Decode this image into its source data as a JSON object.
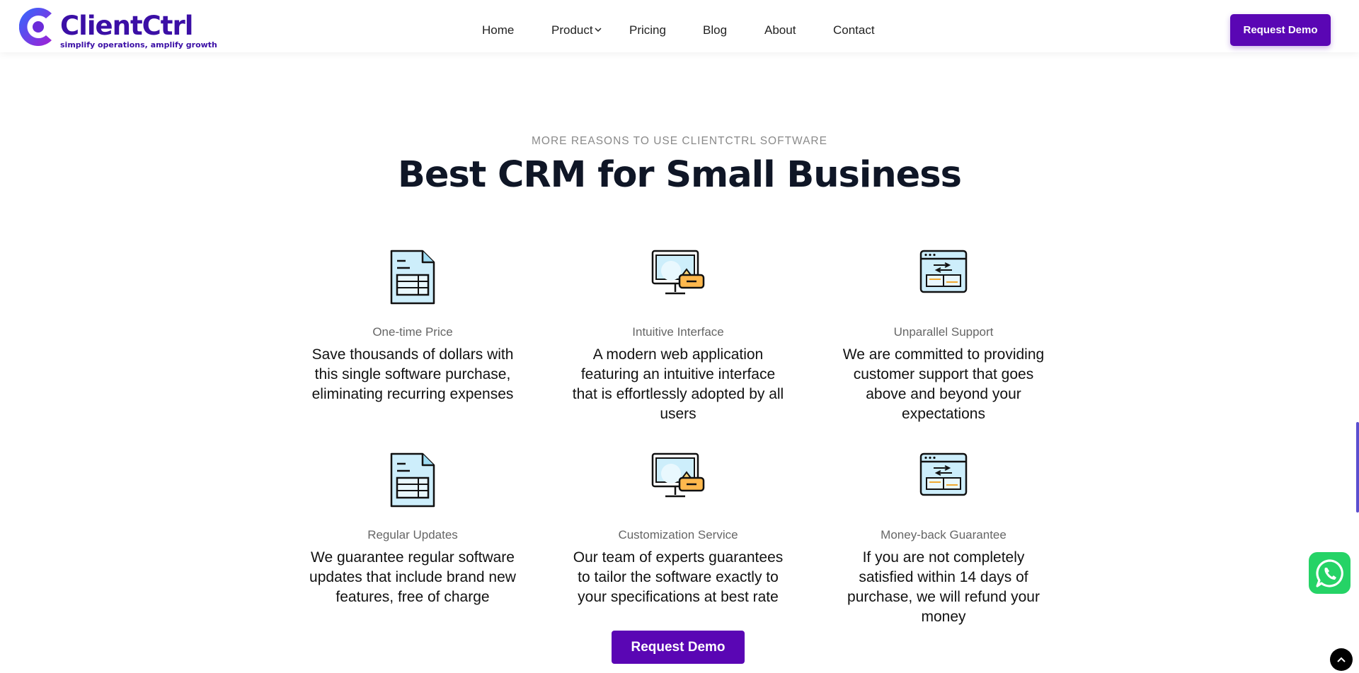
{
  "brand": {
    "name": "ClientCtrl",
    "tagline": "simplify operations, amplify growth",
    "colors": {
      "primary": "#5a06b4",
      "logo_gradient_start": "#2f6bff",
      "logo_gradient_end": "#a11fd4"
    }
  },
  "nav": {
    "items": [
      {
        "label": "Home"
      },
      {
        "label": "Product",
        "has_dropdown": true
      },
      {
        "label": "Pricing"
      },
      {
        "label": "Blog"
      },
      {
        "label": "About"
      },
      {
        "label": "Contact"
      }
    ]
  },
  "header": {
    "cta_label": "Request Demo"
  },
  "section": {
    "eyebrow": "MORE REASONS TO USE CLIENTCTRL SOFTWARE",
    "title": "Best CRM for Small Business"
  },
  "features": [
    {
      "icon": "document-icon",
      "label": "One-time Price",
      "description": "Save thousands of dollars with this single software purchase, eliminating recurring expenses"
    },
    {
      "icon": "monitor-icon",
      "label": "Intuitive Interface",
      "description": "A modern web application featuring an intuitive interface that is effortlessly adopted by all users"
    },
    {
      "icon": "browser-window-icon",
      "label": "Unparallel Support",
      "description": "We are committed to providing customer support that goes above and beyond your expectations"
    },
    {
      "icon": "document-icon",
      "label": "Regular Updates",
      "description": "We guarantee regular software updates that include brand new features, free of charge"
    },
    {
      "icon": "monitor-icon",
      "label": "Customization Service",
      "description": "Our team of experts guarantees to tailor the software exactly to your specifications at best rate"
    },
    {
      "icon": "browser-window-icon",
      "label": "Money-back Guarantee",
      "description": "If you are not completely satisfied within 14 days of purchase, we will refund your money"
    }
  ],
  "cta": {
    "label": "Request Demo"
  },
  "floating": {
    "whatsapp_icon": "whatsapp-icon",
    "back_to_top_icon": "chevron-up-icon"
  }
}
